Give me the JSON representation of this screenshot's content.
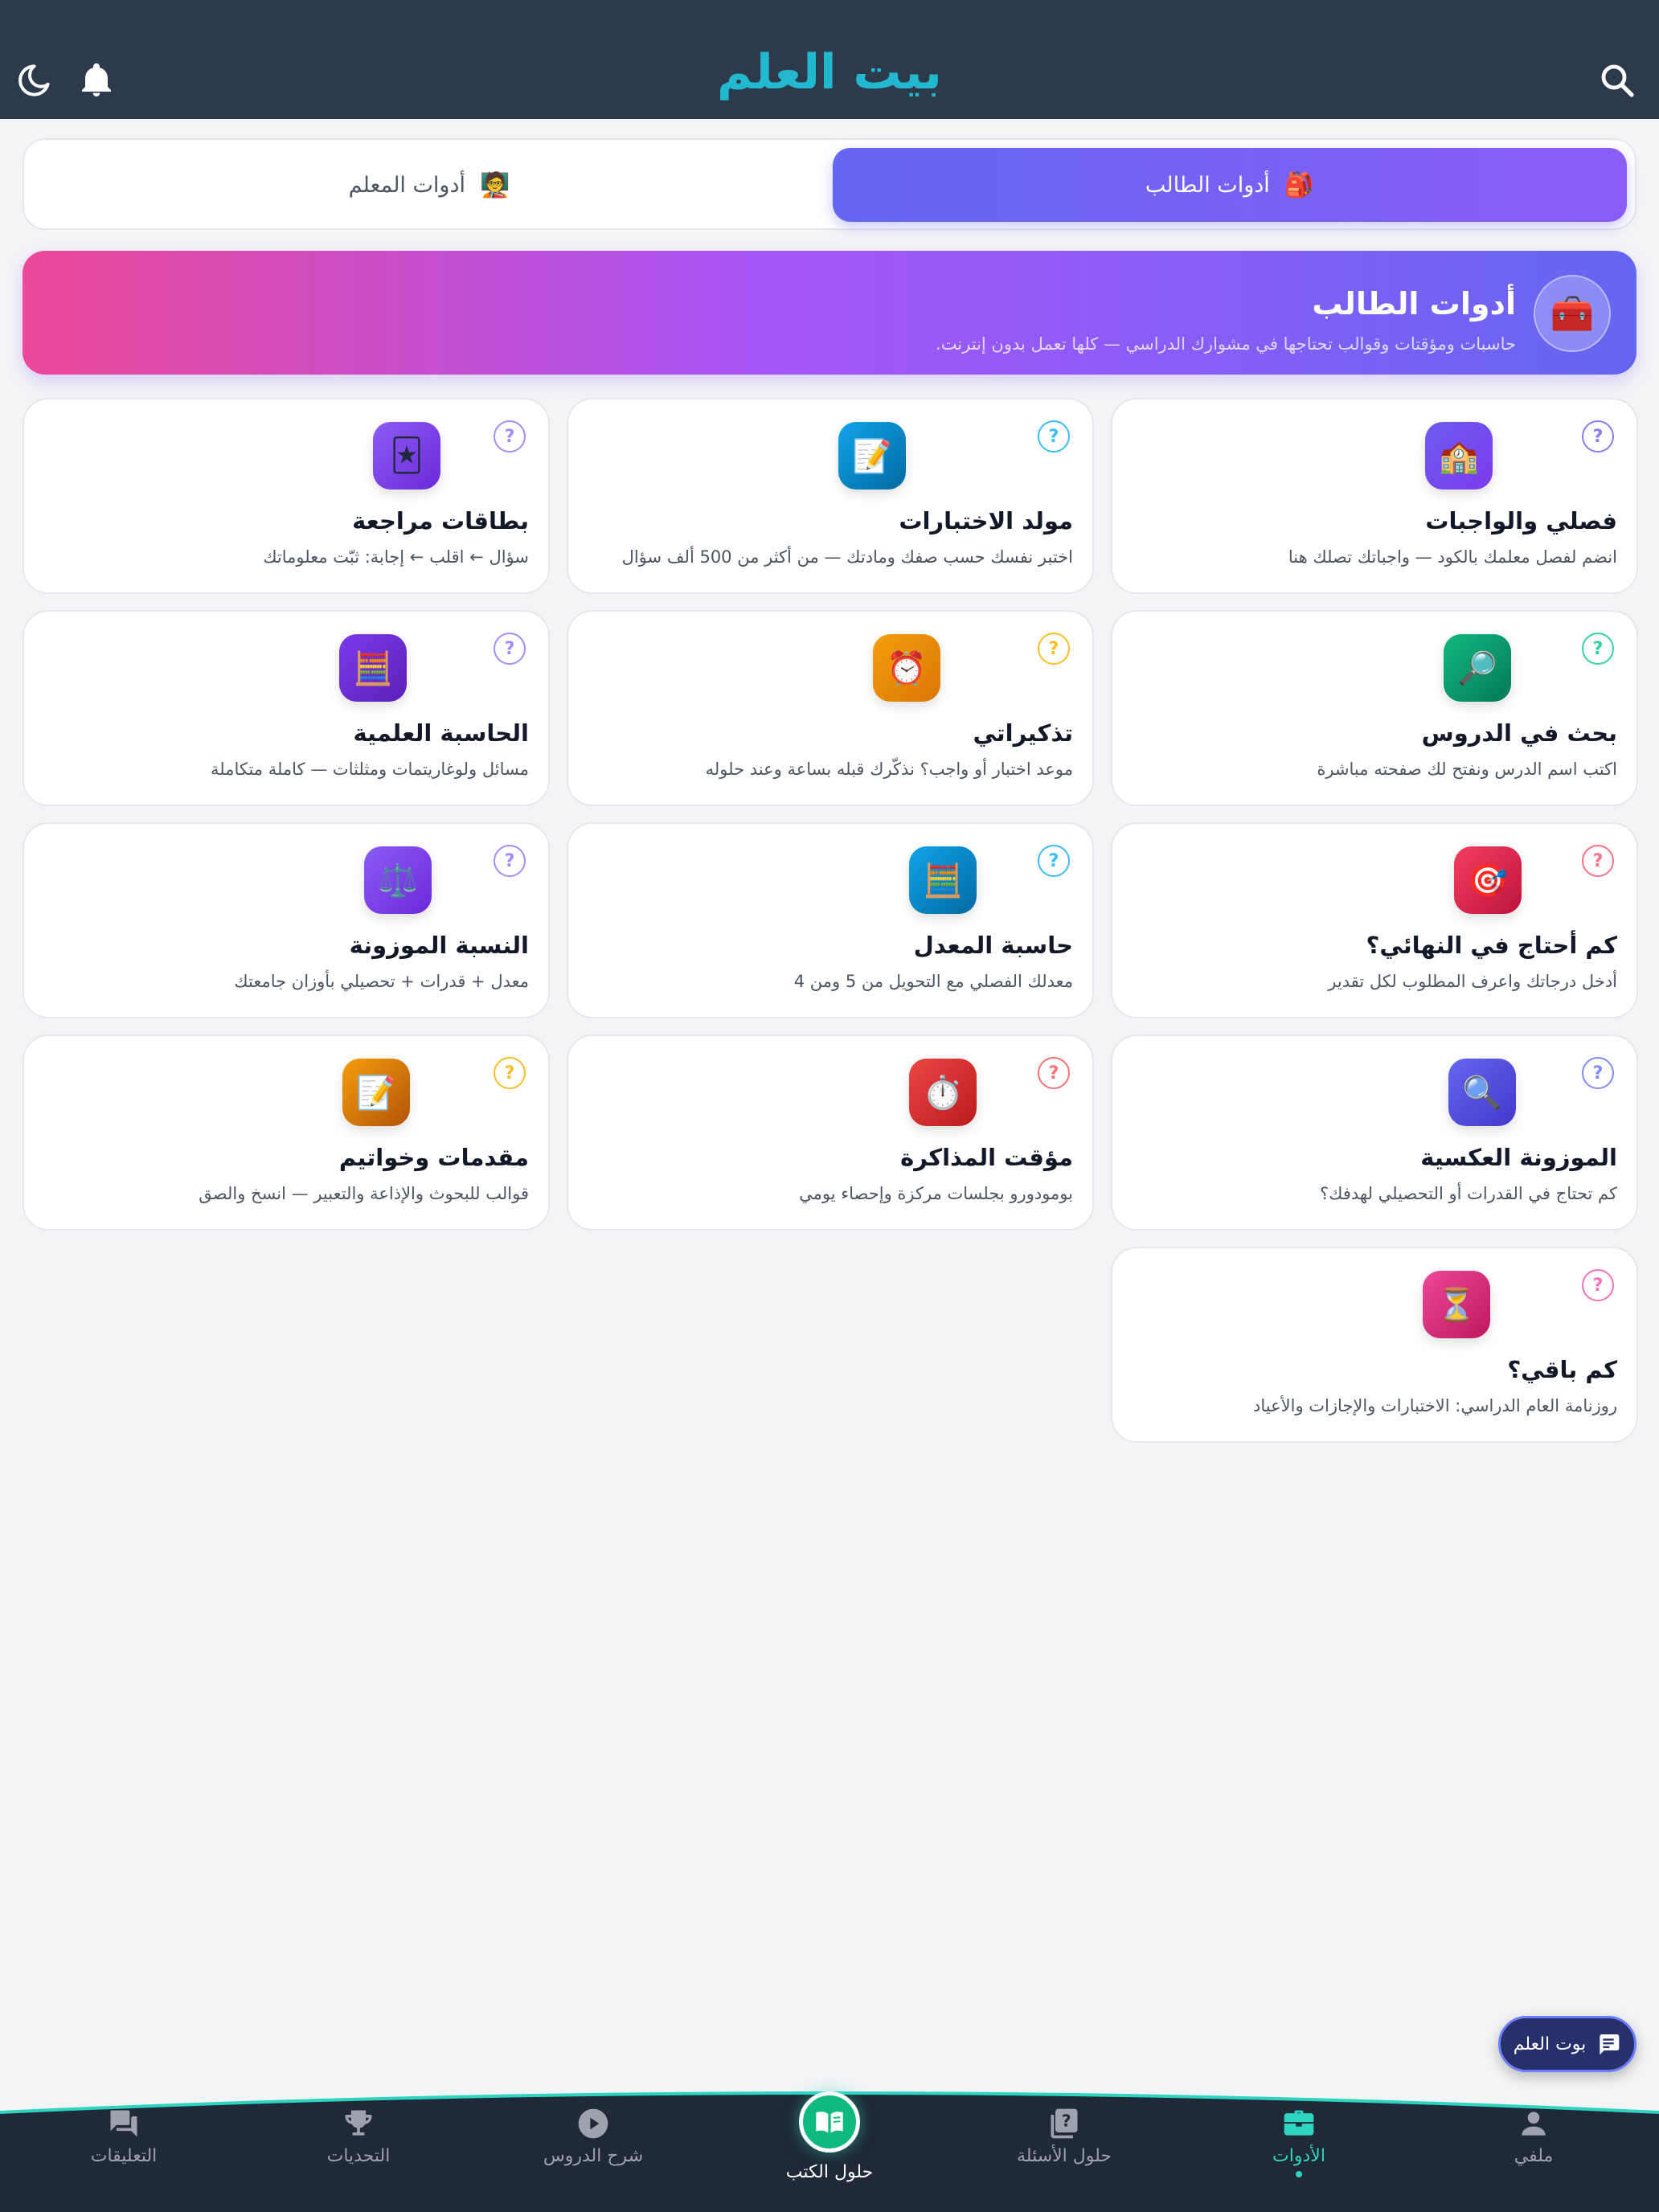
{
  "header": {
    "title": "بيت العلم"
  },
  "tabs": [
    {
      "label": "أدوات الطالب",
      "emoji": "🎒"
    },
    {
      "label": "أدوات المعلم",
      "emoji": "🧑‍🏫"
    }
  ],
  "banner": {
    "emoji": "🧰",
    "title": "أدوات الطالب",
    "subtitle": "حاسبات ومؤقتات وقوالب تحتاجها في مشوارك الدراسي — كلها تعمل بدون إنترنت."
  },
  "help_symbol": "?",
  "tools": [
    {
      "emoji": "🏫",
      "title": "فصلي والواجبات",
      "desc": "انضم لفصل معلمك بالكود — واجباتك تصلك هنا",
      "color": "#6d5cf0",
      "color2": "#7c3aed",
      "badge": "#8b7cf6"
    },
    {
      "emoji": "📝",
      "title": "مولد الاختبارات",
      "desc": "اختبر نفسك حسب صفك ومادتك — من أكثر من 500 ألف سؤال",
      "color": "#0ea5e9",
      "color2": "#0369a1",
      "badge": "#38bdf8"
    },
    {
      "emoji": "🃏",
      "title": "بطاقات مراجعة",
      "desc": "سؤال ← اقلب ← إجابة: ثبّت معلوماتك",
      "color": "#8b5cf6",
      "color2": "#6d28d9",
      "badge": "#a78bfa"
    },
    {
      "emoji": "🔎",
      "title": "بحث في الدروس",
      "desc": "اكتب اسم الدرس ونفتح لك صفحته مباشرة",
      "color": "#10b981",
      "color2": "#047857",
      "badge": "#34d399"
    },
    {
      "emoji": "⏰",
      "title": "تذكيراتي",
      "desc": "موعد اختبار أو واجب؟ نذكّرك قبله بساعة وعند حلوله",
      "color": "#f59e0b",
      "color2": "#d97706",
      "badge": "#fbbf24"
    },
    {
      "emoji": "🧮",
      "title": "الحاسبة العلمية",
      "desc": "مسائل ولوغاريتمات ومثلثات — كاملة متكاملة",
      "color": "#7c3aed",
      "color2": "#5b21b6",
      "badge": "#a78bfa"
    },
    {
      "emoji": "🎯",
      "title": "كم أحتاج في النهائي؟",
      "desc": "أدخل درجاتك واعرف المطلوب لكل تقدير",
      "color": "#f43f5e",
      "color2": "#be123c",
      "badge": "#fb7185"
    },
    {
      "emoji": "🧮",
      "title": "حاسبة المعدل",
      "desc": "معدلك الفصلي مع التحويل من 5 ومن 4",
      "color": "#0ea5e9",
      "color2": "#0369a1",
      "badge": "#38bdf8"
    },
    {
      "emoji": "⚖️",
      "title": "النسبة الموزونة",
      "desc": "معدل + قدرات + تحصيلي بأوزان جامعتك",
      "color": "#8b5cf6",
      "color2": "#6d28d9",
      "badge": "#a78bfa"
    },
    {
      "emoji": "🔍",
      "title": "الموزونة العكسية",
      "desc": "كم تحتاج في القدرات أو التحصيلي لهدفك؟",
      "color": "#6366f1",
      "color2": "#4338ca",
      "badge": "#818cf8"
    },
    {
      "emoji": "⏱️",
      "title": "مؤقت المذاكرة",
      "desc": "بومودورو بجلسات مركزة وإحصاء يومي",
      "color": "#ef4444",
      "color2": "#b91c1c",
      "badge": "#f87171"
    },
    {
      "emoji": "📝",
      "title": "مقدمات وخواتيم",
      "desc": "قوالب للبحوث والإذاعة والتعبير — انسخ والصق",
      "color": "#f59e0b",
      "color2": "#b45309",
      "badge": "#fbbf24"
    },
    {
      "emoji": "⏳",
      "title": "كم باقي؟",
      "desc": "روزنامة العام الدراسي: الاختبارات والإجازات والأعياد",
      "color": "#ec4899",
      "color2": "#be185d",
      "badge": "#f472b6"
    }
  ],
  "bot_button": {
    "label": "بوت العلم"
  },
  "bottom_nav": {
    "profile": "ملفي",
    "tools": "الأدوات",
    "questions": "حلول الأسئلة",
    "books": "حلول الكتب",
    "lessons": "شرح الدروس",
    "challenges": "التحديات",
    "comments": "التعليقات"
  },
  "colors": {
    "header_bg": "#2d3a4c",
    "brand": "#22b8cf",
    "accent": "#2dd4bf"
  }
}
